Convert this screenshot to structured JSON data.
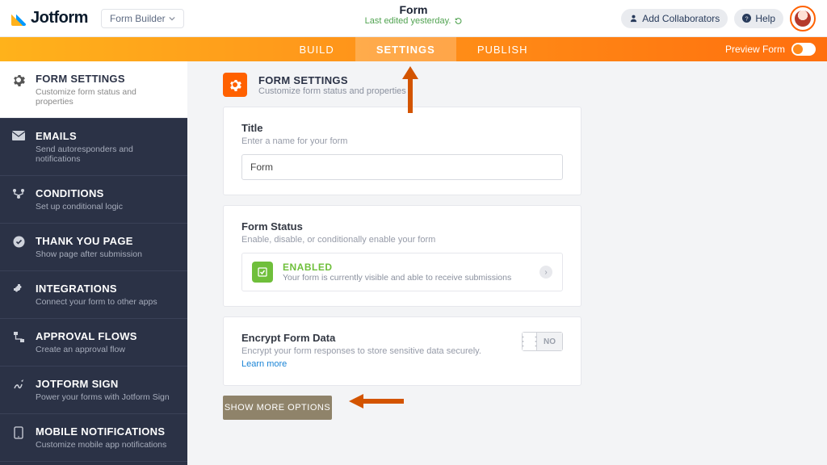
{
  "brand": "Jotform",
  "formBuilderLabel": "Form Builder",
  "top": {
    "title": "Form",
    "lastEdited": "Last edited yesterday.",
    "addCollab": "Add Collaborators",
    "help": "Help",
    "preview": "Preview Form"
  },
  "tabs": {
    "build": "BUILD",
    "settings": "SETTINGS",
    "publish": "PUBLISH"
  },
  "sidebar": {
    "items": [
      {
        "label": "FORM SETTINGS",
        "sub": "Customize form status and properties"
      },
      {
        "label": "EMAILS",
        "sub": "Send autoresponders and notifications"
      },
      {
        "label": "CONDITIONS",
        "sub": "Set up conditional logic"
      },
      {
        "label": "THANK YOU PAGE",
        "sub": "Show page after submission"
      },
      {
        "label": "INTEGRATIONS",
        "sub": "Connect your form to other apps"
      },
      {
        "label": "APPROVAL FLOWS",
        "sub": "Create an approval flow"
      },
      {
        "label": "JOTFORM SIGN",
        "sub": "Power your forms with Jotform Sign"
      },
      {
        "label": "MOBILE NOTIFICATIONS",
        "sub": "Customize mobile app notifications"
      }
    ]
  },
  "panel": {
    "title": "FORM SETTINGS",
    "sub": "Customize form status and properties",
    "titleField": {
      "label": "Title",
      "help": "Enter a name for your form",
      "value": "Form"
    },
    "statusField": {
      "label": "Form Status",
      "help": "Enable, disable, or conditionally enable your form",
      "statusTitle": "ENABLED",
      "statusSub": "Your form is currently visible and able to receive submissions"
    },
    "encrypt": {
      "label": "Encrypt Form Data",
      "help": "Encrypt your form responses to store sensitive data securely.",
      "learn": "Learn more",
      "toggle": "NO"
    },
    "showMore": "SHOW MORE OPTIONS"
  }
}
